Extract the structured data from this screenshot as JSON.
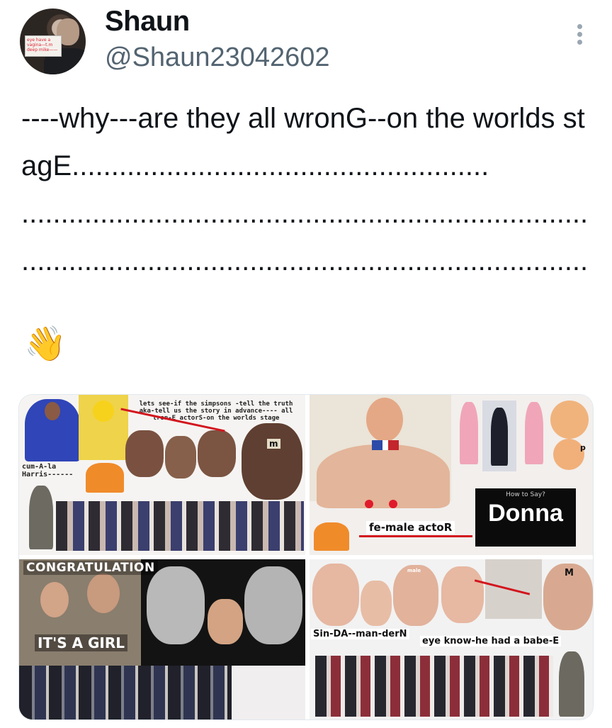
{
  "author": {
    "display_name": "Shaun",
    "handle": "@Shaun23042602",
    "avatar_sign_text": "eye have a vagina—t.m deep mike——"
  },
  "tweet": {
    "text": "----why---are they all wronG--on the worlds stagE.....................................................\n........................................................................\n........................................................................",
    "emoji": "👋"
  },
  "media": {
    "image1": {
      "top_caption": "lets see-if the simpsons -tell the truth aka-tell us the story in advance---- all tron-E actorS-on the worlds stage",
      "side_label": "cum-A-la Harris------",
      "mark": "m"
    },
    "image2": {
      "center_label": "fe-male actoR",
      "donna_subtitle": "How to Say?",
      "donna_title": "Donna",
      "mark": "p"
    },
    "image3": {
      "banner_top": "CONGRATULATION",
      "banner_bottom": "IT'S A GIRL"
    },
    "image4": {
      "label_left": "Sin-DA--man-derN",
      "label_right": "eye know-he had a babe-E",
      "mark_m": "M",
      "mark_male": "male"
    }
  },
  "colors": {
    "text_primary": "#0f1419",
    "text_secondary": "#536471",
    "arrow_red": "#d2161e"
  },
  "icons": {
    "more": "more-vertical-icon",
    "emoji": "waving-hand-emoji"
  }
}
